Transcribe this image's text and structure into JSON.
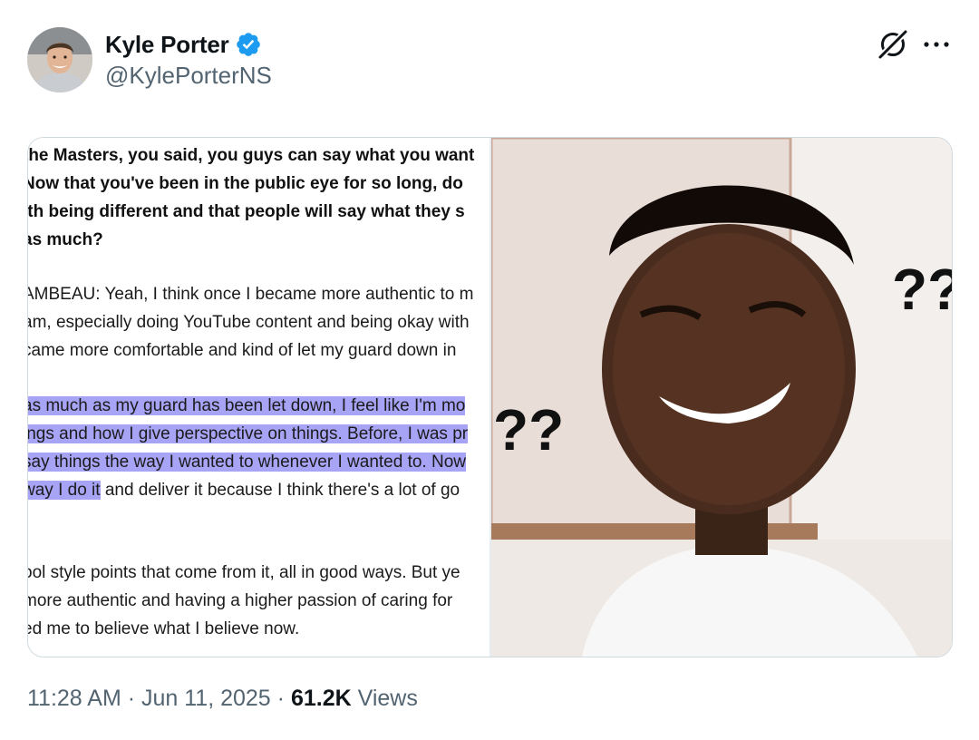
{
  "author": {
    "name": "Kyle Porter",
    "handle": "@KylePorterNS",
    "verified": true
  },
  "icons": {
    "verified": "verified-badge-icon",
    "grok": "grok-icon",
    "more": "more-options-icon"
  },
  "colors": {
    "verified_blue": "#1d9bf0",
    "muted_text": "#536471",
    "highlight": "#a7a3f5"
  },
  "media": {
    "document_lines": [
      "the Masters, you said, you guys can say what you want",
      " Now that you've been in the public eye for so long, do",
      "ith being different and that people will say what they s",
      " as much?",
      "AMBEAU: Yeah, I think once I became more authentic to m",
      "am, especially doing YouTube content and being okay with",
      "came more comfortable and kind of let my guard down in",
      " as much as my guard has been let down, I feel like I'm mo",
      "ings and how I give perspective on things. Before, I was pr",
      "say things the way I wanted to whenever I wanted to. Now",
      " way I do it",
      " and deliver it because I think there's a lot of go",
      ".",
      "ool style points that come from it, all in good ways. But ye",
      " more authentic and having a higher passion of caring for",
      "ed me to believe what I believe now."
    ],
    "meme_marks": [
      "??",
      "??"
    ]
  },
  "meta": {
    "time": "11:28 AM",
    "separator": " · ",
    "date": "Jun 11, 2025",
    "views_count": "61.2K",
    "views_label": " Views"
  }
}
